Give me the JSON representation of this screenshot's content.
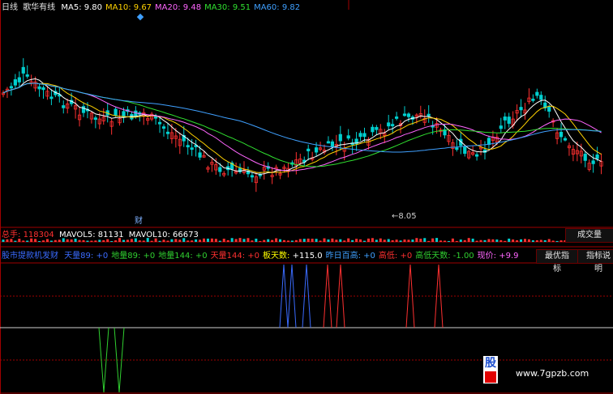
{
  "main_header": {
    "period": "日线",
    "stock_name": "歌华有线",
    "ma": [
      {
        "label": "MA5: ",
        "value": "9.80",
        "color": "#ffffff"
      },
      {
        "label": "MA10: ",
        "value": "9.67",
        "color": "#ffd200"
      },
      {
        "label": "MA20: ",
        "value": "9.48",
        "color": "#ff66ff"
      },
      {
        "label": "MA30: ",
        "value": "9.51",
        "color": "#30e030"
      },
      {
        "label": "MA60: ",
        "value": "9.82",
        "color": "#3fa0ff"
      }
    ]
  },
  "annotations": {
    "finance_marker": "财",
    "low_price_label": "←8.05"
  },
  "volume_header": {
    "total_label": "总手: ",
    "total_value": "118304",
    "mavol5_label": "MAVOL5: ",
    "mavol5_value": "81131",
    "mavol10_label": "MAVOL10: ",
    "mavol10_value": "66673"
  },
  "volume_tab": "成交量",
  "indicator_header": {
    "name": "股市提款机发财",
    "items": [
      {
        "label": "天量89: ",
        "value": "+0",
        "color": "#3a6bff"
      },
      {
        "label": "地量89: ",
        "value": "+0",
        "color": "#30d030"
      },
      {
        "label": "地量144: ",
        "value": "+0",
        "color": "#30d030"
      },
      {
        "label": "天量144: ",
        "value": "+0",
        "color": "#ff3030"
      },
      {
        "label": "板天数: ",
        "value": "+115.0",
        "color": "#ffff00"
      },
      {
        "label": "昨日百高: ",
        "value": "+0",
        "color": "#3fa0ff"
      },
      {
        "label": "高低: ",
        "value": "+0",
        "color": "#ff3030"
      },
      {
        "label": "高低天数: ",
        "value": "-1.00",
        "color": "#30d030"
      },
      {
        "label": "现价: ",
        "value": "+9.9",
        "color": "#ff66ff"
      }
    ]
  },
  "indicator_tabs": [
    "最优指标",
    "指标说明"
  ],
  "watermark": {
    "url": "www.7gpzb.com",
    "logo_text": "股"
  },
  "colors": {
    "up": "#ff3030",
    "down": "#00d0d0",
    "grid": "#a00000",
    "flag": "#3fa0ff"
  }
}
